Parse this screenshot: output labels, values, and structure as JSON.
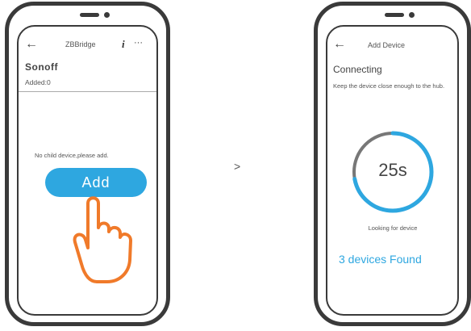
{
  "screen1": {
    "title": "ZBBridge",
    "info_icon_glyph": "i",
    "more_icon_glyph": "···",
    "brand": "Sonoff",
    "added": "Added:0",
    "empty_message": "No child device,please add.",
    "add_button": "Add"
  },
  "separator": ">",
  "screen2": {
    "title": "Add Device",
    "status": "Connecting",
    "hint": "Keep the device close enough to the hub.",
    "countdown": "25s",
    "progress": 0.72,
    "looking": "Looking for device",
    "found": "3 devices Found"
  },
  "icons": {
    "back": "back-arrow-icon",
    "info": "info-icon",
    "more": "more-icon",
    "hand": "pointing-hand-icon"
  },
  "colors": {
    "accent": "#2ea7e0",
    "hand_outline": "#f07a2a",
    "frame": "#3a3a3a",
    "ring_track": "#777777"
  }
}
